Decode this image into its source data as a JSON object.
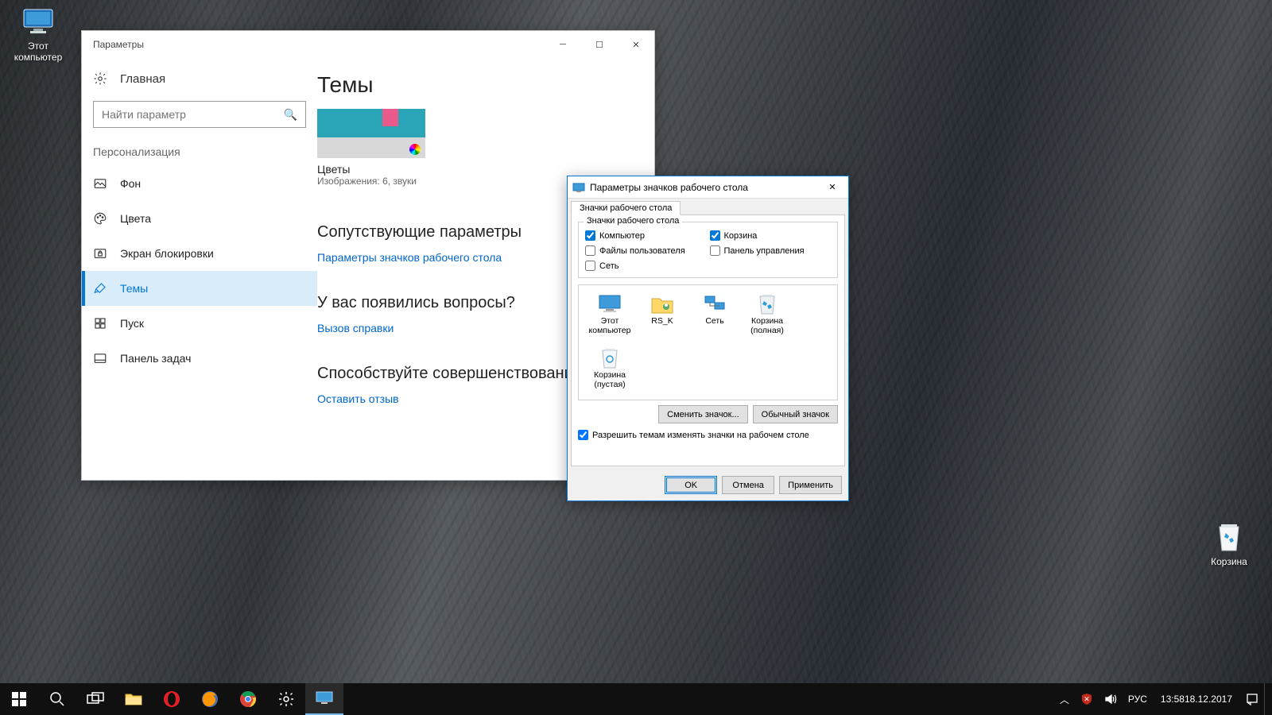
{
  "desktop_icons": {
    "this_pc": "Этот\nкомпьютер",
    "recycle": "Корзина"
  },
  "settings": {
    "title": "Параметры",
    "home": "Главная",
    "search_placeholder": "Найти параметр",
    "section": "Персонализация",
    "nav": {
      "background": "Фон",
      "colors": "Цвета",
      "lockscreen": "Экран блокировки",
      "themes": "Темы",
      "start": "Пуск",
      "taskbar": "Панель задач"
    },
    "main": {
      "heading": "Темы",
      "theme_name": "Цветы",
      "theme_sub": "Изображения: 6, звуки",
      "related_heading": "Сопутствующие параметры",
      "related_link": "Параметры значков рабочего стола",
      "questions_heading": "У вас появились вопросы?",
      "questions_link": "Вызов справки",
      "improve_heading": "Способствуйте совершенствованию",
      "improve_link": "Оставить отзыв"
    }
  },
  "dialog": {
    "title": "Параметры значков рабочего стола",
    "tab": "Значки рабочего стола",
    "group_legend": "Значки рабочего стола",
    "checks": {
      "computer": "Компьютер",
      "user_files": "Файлы пользователя",
      "network": "Сеть",
      "recycle": "Корзина",
      "control_panel": "Панель управления"
    },
    "icons": {
      "this_pc": "Этот\nкомпьютер",
      "user": "RS_K",
      "network": "Сеть",
      "bin_full": "Корзина\n(полная)",
      "bin_empty": "Корзина\n(пустая)"
    },
    "change_icon": "Сменить значок...",
    "default_icon": "Обычный значок",
    "allow_themes": "Разрешить темам изменять значки на рабочем столе",
    "ok": "OK",
    "cancel": "Отмена",
    "apply": "Применить"
  },
  "taskbar": {
    "lang": "РУС",
    "time": "13:58",
    "date": "18.12.2017"
  }
}
